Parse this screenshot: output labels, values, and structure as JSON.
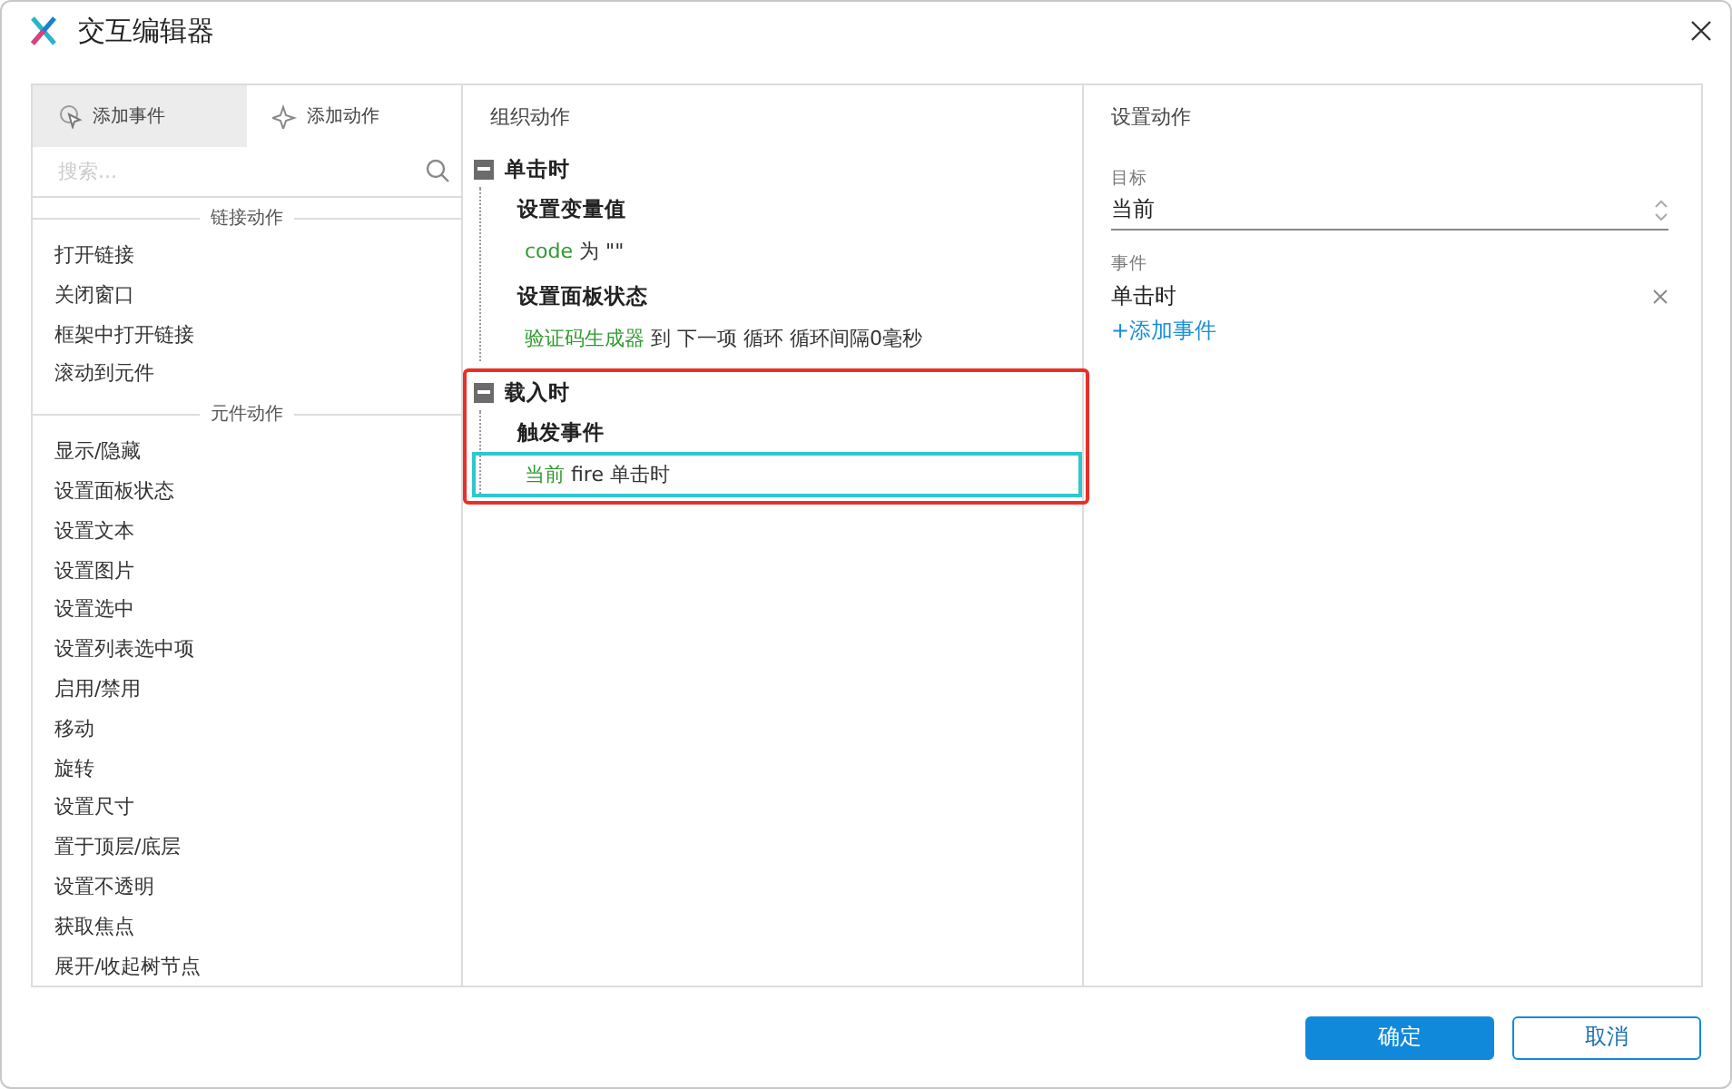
{
  "window": {
    "title": "交互编辑器"
  },
  "left_panel": {
    "tabs": [
      {
        "label": "添加事件",
        "selected": true
      },
      {
        "label": "添加动作",
        "selected": false
      }
    ],
    "search": {
      "placeholder": "搜索..."
    },
    "sections": [
      {
        "title": "链接动作",
        "items": [
          "打开链接",
          "关闭窗口",
          "框架中打开链接",
          "滚动到元件"
        ]
      },
      {
        "title": "元件动作",
        "items": [
          "显示/隐藏",
          "设置面板状态",
          "设置文本",
          "设置图片",
          "设置选中",
          "设置列表选中项",
          "启用/禁用",
          "移动",
          "旋转",
          "设置尺寸",
          "置于顶层/底层",
          "设置不透明",
          "获取焦点",
          "展开/收起树节点"
        ]
      }
    ]
  },
  "middle_panel": {
    "title": "组织动作",
    "groups": [
      {
        "event": "单击时",
        "expanded": true,
        "highlighted": false,
        "actions": [
          {
            "title": "设置变量值",
            "target": "code",
            "text": "为 \"\"",
            "selected": false
          },
          {
            "title": "设置面板状态",
            "target": "验证码生成器",
            "text": "到 下一项 循环 循环间隔0毫秒",
            "selected": false
          }
        ]
      },
      {
        "event": "载入时",
        "expanded": true,
        "highlighted": true,
        "actions": [
          {
            "title": "触发事件",
            "target": "当前",
            "text": "fire 单击时",
            "selected": true
          }
        ]
      }
    ]
  },
  "right_panel": {
    "title": "设置动作",
    "target_label": "目标",
    "target_value": "当前",
    "events_label": "事件",
    "events": [
      "单击时"
    ],
    "add_event": "+添加事件"
  },
  "buttons": [
    {
      "label": "确定",
      "primary": true
    },
    {
      "label": "取消",
      "primary": false
    }
  ]
}
